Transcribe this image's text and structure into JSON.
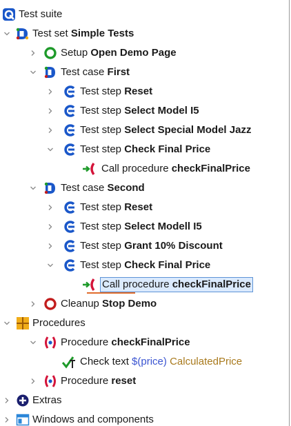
{
  "tree": {
    "rows": [
      {
        "prefix": "Test suite",
        "name": ""
      },
      {
        "prefix": "Test set ",
        "name": "Simple Tests"
      },
      {
        "prefix": "Setup ",
        "name": "Open Demo Page"
      },
      {
        "prefix": "Test case ",
        "name": "First"
      },
      {
        "prefix": "Test step ",
        "name": "Reset"
      },
      {
        "prefix": "Test step ",
        "name": "Select Model I5"
      },
      {
        "prefix": "Test step ",
        "name": "Select Special Model Jazz"
      },
      {
        "prefix": "Test step ",
        "name": "Check Final Price"
      },
      {
        "prefix": "Call procedure ",
        "name": "checkFinalPrice"
      },
      {
        "prefix": "Test case ",
        "name": "Second"
      },
      {
        "prefix": "Test step ",
        "name": "Reset"
      },
      {
        "prefix": "Test step ",
        "name": "Select Modell I5"
      },
      {
        "prefix": "Test step ",
        "name": "Grant 10% Discount"
      },
      {
        "prefix": "Test step ",
        "name": "Check Final Price"
      },
      {
        "prefix": "Call procedure ",
        "name": "checkFinalPrice"
      },
      {
        "prefix": "Cleanup ",
        "name": "Stop Demo"
      },
      {
        "prefix": "Procedures",
        "name": ""
      },
      {
        "prefix": "Procedure ",
        "name": "checkFinalPrice"
      },
      {
        "prefix": "Check text ",
        "var": "$(price)",
        "cls": "CalculatedPrice"
      },
      {
        "prefix": "Procedure ",
        "name": "reset"
      },
      {
        "prefix": "Extras",
        "name": ""
      },
      {
        "prefix": "Windows and components",
        "name": ""
      }
    ]
  },
  "selected_row": 14,
  "colors": {
    "selection_bg": "#dbeafd",
    "selection_border": "#5d93d6",
    "accent_blue": "#1a57c9",
    "setup_green": "#1e9a2a",
    "cleanup_red": "#c21d1d",
    "procedure_red": "#d4143a",
    "package_yellow": "#f1ad1a",
    "variable_blue": "#3a54d1",
    "component_orange": "#a8791c"
  }
}
